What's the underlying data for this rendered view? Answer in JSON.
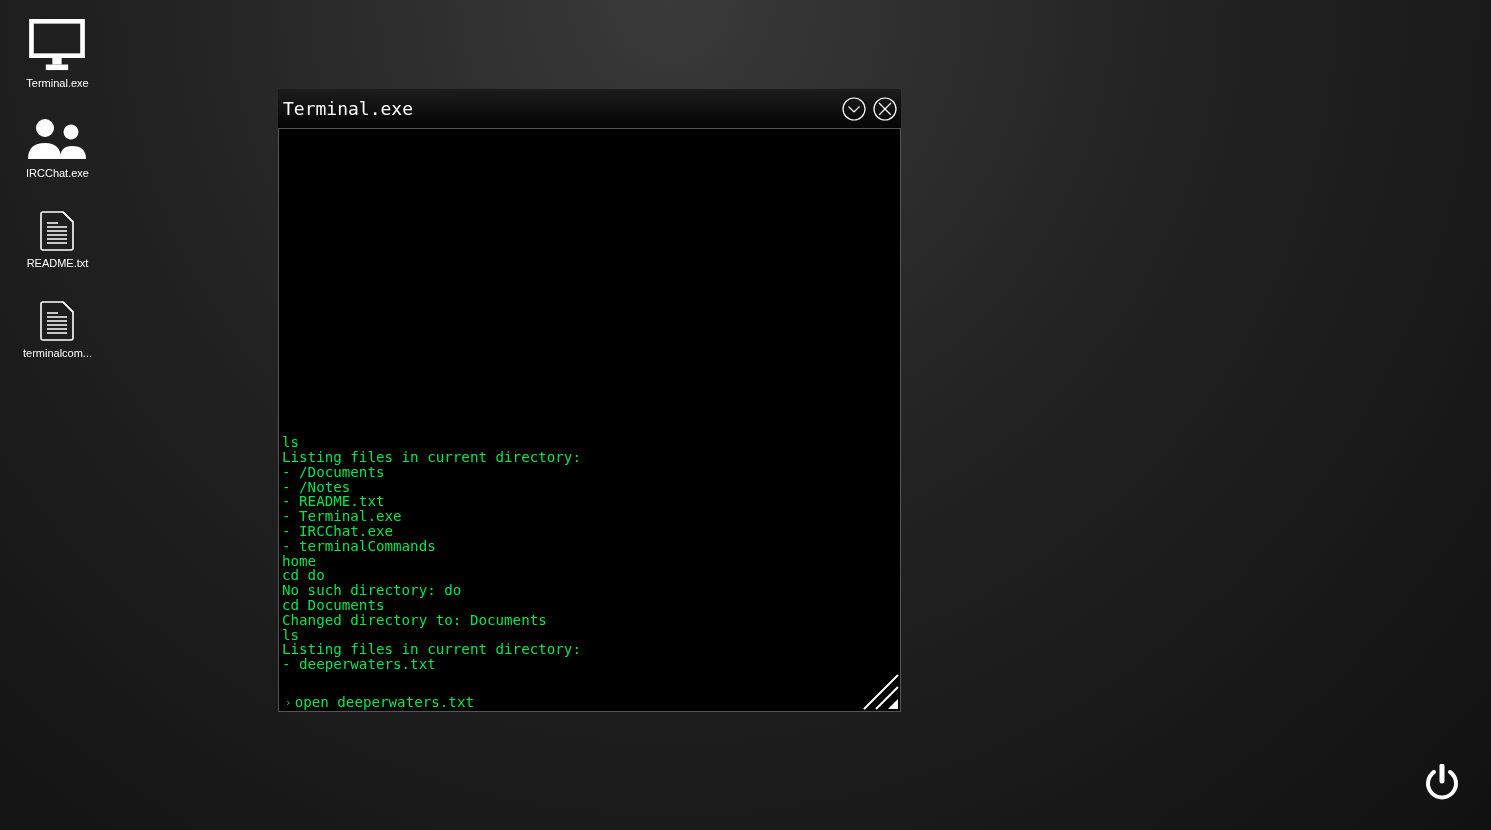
{
  "desktop_icons": [
    {
      "kind": "monitor",
      "label": "Terminal.exe"
    },
    {
      "kind": "users",
      "label": "IRCChat.exe"
    },
    {
      "kind": "document",
      "label": "README.txt"
    },
    {
      "kind": "document",
      "label": "terminalcom..."
    }
  ],
  "window": {
    "title": "Terminal.exe",
    "output": [
      "ls",
      "Listing files in current directory:",
      "- /Documents",
      "- /Notes",
      "- README.txt",
      "- Terminal.exe",
      "- IRCChat.exe",
      "- terminalCommands",
      "home",
      "cd do",
      "No such directory: do",
      "cd Documents",
      "Changed directory to: Documents",
      "ls",
      "Listing files in current directory:",
      "- deeperwaters.txt"
    ],
    "prompt": {
      "symbol": "›",
      "value": "open deeperwaters.txt"
    }
  }
}
